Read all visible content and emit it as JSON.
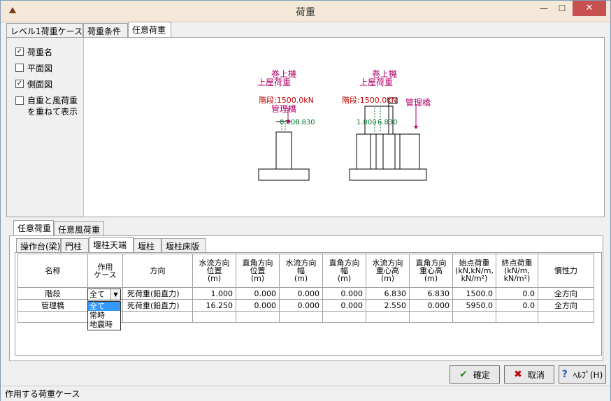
{
  "window": {
    "title": "荷重",
    "app_icon": "arrow-up-icon",
    "close_label": "✕",
    "min_label": "—",
    "max_label": "☐"
  },
  "top_tabs": [
    "レベル1荷重ケース",
    "荷重条件",
    "任意荷重"
  ],
  "options": [
    {
      "label": "荷重名",
      "checked": true
    },
    {
      "label": "平面図",
      "checked": false
    },
    {
      "label": "側面図",
      "checked": true
    },
    {
      "label": "自重と風荷重\nを重ねて表示",
      "checked": false
    }
  ],
  "diagram": {
    "left": {
      "name1": "巻上機",
      "name2": "上屋荷重",
      "load": "階段:1500.0kN",
      "label3": "管理橋",
      "dim1": "0.000",
      "dim2": "6.830"
    },
    "right": {
      "name1": "巻上機",
      "name2": "上屋荷重",
      "load": "階段:1500.0kN",
      "label3": "管理橋",
      "dim1": "1.000",
      "dim2": "6.830"
    }
  },
  "bottom_tabs1": [
    "任意荷重",
    "任意風荷重"
  ],
  "bottom_tabs2": [
    "操作台(梁)",
    "門柱",
    "堰柱天端",
    "堰柱",
    "堰柱床版"
  ],
  "table": {
    "headers": [
      "名称",
      "作用\nケース",
      "方向",
      "水流方向\n位置\n(m)",
      "直角方向\n位置\n(m)",
      "水流方向\n幅\n(m)",
      "直角方向\n幅\n(m)",
      "水流方向\n重心高\n(m)",
      "直角方向\n重心高\n(m)",
      "始点荷重\n(kN,kN/m,\nkN/m²)",
      "終点荷重\n(kN/m,\nkN/m²)",
      "慣性力"
    ],
    "rows": [
      [
        "階段",
        "全て",
        "死荷重(鉛直力)",
        "1.000",
        "0.000",
        "0.000",
        "0.000",
        "6.830",
        "6.830",
        "1500.0",
        "0.0",
        "全方向"
      ],
      [
        "管理橋",
        "",
        "死荷重(鉛直力)",
        "16.250",
        "0.000",
        "0.000",
        "0.000",
        "2.550",
        "0.000",
        "5950.0",
        "0.0",
        "全方向"
      ]
    ]
  },
  "combo": {
    "value": "全て",
    "options": [
      "全て",
      "常時",
      "地震時"
    ],
    "selected_index": 0
  },
  "buttons": {
    "ok": "確定",
    "cancel": "取消",
    "help": "ﾍﾙﾌﾟ(H)"
  },
  "status": "作用する荷重ケース",
  "colors": {
    "load_label": "#b0006a",
    "dim": "#0a7a3a",
    "load_value": "#c00000"
  }
}
